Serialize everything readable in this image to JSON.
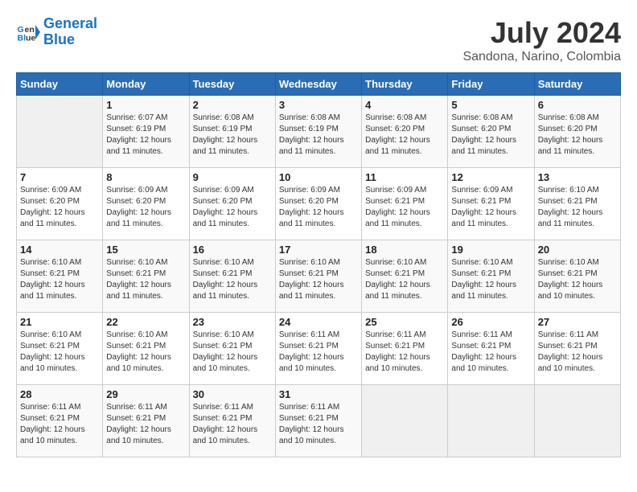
{
  "header": {
    "logo_line1": "General",
    "logo_line2": "Blue",
    "month": "July 2024",
    "location": "Sandona, Narino, Colombia"
  },
  "weekdays": [
    "Sunday",
    "Monday",
    "Tuesday",
    "Wednesday",
    "Thursday",
    "Friday",
    "Saturday"
  ],
  "weeks": [
    [
      {
        "day": "",
        "sunrise": "",
        "sunset": "",
        "daylight": "",
        "empty": true
      },
      {
        "day": "1",
        "sunrise": "Sunrise: 6:07 AM",
        "sunset": "Sunset: 6:19 PM",
        "daylight": "Daylight: 12 hours and 11 minutes."
      },
      {
        "day": "2",
        "sunrise": "Sunrise: 6:08 AM",
        "sunset": "Sunset: 6:19 PM",
        "daylight": "Daylight: 12 hours and 11 minutes."
      },
      {
        "day": "3",
        "sunrise": "Sunrise: 6:08 AM",
        "sunset": "Sunset: 6:19 PM",
        "daylight": "Daylight: 12 hours and 11 minutes."
      },
      {
        "day": "4",
        "sunrise": "Sunrise: 6:08 AM",
        "sunset": "Sunset: 6:20 PM",
        "daylight": "Daylight: 12 hours and 11 minutes."
      },
      {
        "day": "5",
        "sunrise": "Sunrise: 6:08 AM",
        "sunset": "Sunset: 6:20 PM",
        "daylight": "Daylight: 12 hours and 11 minutes."
      },
      {
        "day": "6",
        "sunrise": "Sunrise: 6:08 AM",
        "sunset": "Sunset: 6:20 PM",
        "daylight": "Daylight: 12 hours and 11 minutes."
      }
    ],
    [
      {
        "day": "7",
        "sunrise": "Sunrise: 6:09 AM",
        "sunset": "Sunset: 6:20 PM",
        "daylight": "Daylight: 12 hours and 11 minutes."
      },
      {
        "day": "8",
        "sunrise": "Sunrise: 6:09 AM",
        "sunset": "Sunset: 6:20 PM",
        "daylight": "Daylight: 12 hours and 11 minutes."
      },
      {
        "day": "9",
        "sunrise": "Sunrise: 6:09 AM",
        "sunset": "Sunset: 6:20 PM",
        "daylight": "Daylight: 12 hours and 11 minutes."
      },
      {
        "day": "10",
        "sunrise": "Sunrise: 6:09 AM",
        "sunset": "Sunset: 6:20 PM",
        "daylight": "Daylight: 12 hours and 11 minutes."
      },
      {
        "day": "11",
        "sunrise": "Sunrise: 6:09 AM",
        "sunset": "Sunset: 6:21 PM",
        "daylight": "Daylight: 12 hours and 11 minutes."
      },
      {
        "day": "12",
        "sunrise": "Sunrise: 6:09 AM",
        "sunset": "Sunset: 6:21 PM",
        "daylight": "Daylight: 12 hours and 11 minutes."
      },
      {
        "day": "13",
        "sunrise": "Sunrise: 6:10 AM",
        "sunset": "Sunset: 6:21 PM",
        "daylight": "Daylight: 12 hours and 11 minutes."
      }
    ],
    [
      {
        "day": "14",
        "sunrise": "Sunrise: 6:10 AM",
        "sunset": "Sunset: 6:21 PM",
        "daylight": "Daylight: 12 hours and 11 minutes."
      },
      {
        "day": "15",
        "sunrise": "Sunrise: 6:10 AM",
        "sunset": "Sunset: 6:21 PM",
        "daylight": "Daylight: 12 hours and 11 minutes."
      },
      {
        "day": "16",
        "sunrise": "Sunrise: 6:10 AM",
        "sunset": "Sunset: 6:21 PM",
        "daylight": "Daylight: 12 hours and 11 minutes."
      },
      {
        "day": "17",
        "sunrise": "Sunrise: 6:10 AM",
        "sunset": "Sunset: 6:21 PM",
        "daylight": "Daylight: 12 hours and 11 minutes."
      },
      {
        "day": "18",
        "sunrise": "Sunrise: 6:10 AM",
        "sunset": "Sunset: 6:21 PM",
        "daylight": "Daylight: 12 hours and 11 minutes."
      },
      {
        "day": "19",
        "sunrise": "Sunrise: 6:10 AM",
        "sunset": "Sunset: 6:21 PM",
        "daylight": "Daylight: 12 hours and 11 minutes."
      },
      {
        "day": "20",
        "sunrise": "Sunrise: 6:10 AM",
        "sunset": "Sunset: 6:21 PM",
        "daylight": "Daylight: 12 hours and 10 minutes."
      }
    ],
    [
      {
        "day": "21",
        "sunrise": "Sunrise: 6:10 AM",
        "sunset": "Sunset: 6:21 PM",
        "daylight": "Daylight: 12 hours and 10 minutes."
      },
      {
        "day": "22",
        "sunrise": "Sunrise: 6:10 AM",
        "sunset": "Sunset: 6:21 PM",
        "daylight": "Daylight: 12 hours and 10 minutes."
      },
      {
        "day": "23",
        "sunrise": "Sunrise: 6:10 AM",
        "sunset": "Sunset: 6:21 PM",
        "daylight": "Daylight: 12 hours and 10 minutes."
      },
      {
        "day": "24",
        "sunrise": "Sunrise: 6:11 AM",
        "sunset": "Sunset: 6:21 PM",
        "daylight": "Daylight: 12 hours and 10 minutes."
      },
      {
        "day": "25",
        "sunrise": "Sunrise: 6:11 AM",
        "sunset": "Sunset: 6:21 PM",
        "daylight": "Daylight: 12 hours and 10 minutes."
      },
      {
        "day": "26",
        "sunrise": "Sunrise: 6:11 AM",
        "sunset": "Sunset: 6:21 PM",
        "daylight": "Daylight: 12 hours and 10 minutes."
      },
      {
        "day": "27",
        "sunrise": "Sunrise: 6:11 AM",
        "sunset": "Sunset: 6:21 PM",
        "daylight": "Daylight: 12 hours and 10 minutes."
      }
    ],
    [
      {
        "day": "28",
        "sunrise": "Sunrise: 6:11 AM",
        "sunset": "Sunset: 6:21 PM",
        "daylight": "Daylight: 12 hours and 10 minutes."
      },
      {
        "day": "29",
        "sunrise": "Sunrise: 6:11 AM",
        "sunset": "Sunset: 6:21 PM",
        "daylight": "Daylight: 12 hours and 10 minutes."
      },
      {
        "day": "30",
        "sunrise": "Sunrise: 6:11 AM",
        "sunset": "Sunset: 6:21 PM",
        "daylight": "Daylight: 12 hours and 10 minutes."
      },
      {
        "day": "31",
        "sunrise": "Sunrise: 6:11 AM",
        "sunset": "Sunset: 6:21 PM",
        "daylight": "Daylight: 12 hours and 10 minutes."
      },
      {
        "day": "",
        "sunrise": "",
        "sunset": "",
        "daylight": "",
        "empty": true
      },
      {
        "day": "",
        "sunrise": "",
        "sunset": "",
        "daylight": "",
        "empty": true
      },
      {
        "day": "",
        "sunrise": "",
        "sunset": "",
        "daylight": "",
        "empty": true
      }
    ]
  ]
}
